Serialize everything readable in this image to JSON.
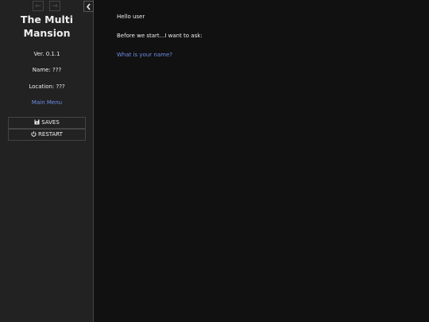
{
  "sidebar": {
    "history_back_icon": "←",
    "history_forward_icon": "→",
    "story_title_line1": "The Multi",
    "story_title_line2": "Mansion",
    "version": "Ver. 0.1.1",
    "name": "Name: ???",
    "location": "Location: ???",
    "main_menu_label": "Main Menu",
    "saves_label": "SAVES",
    "restart_label": "RESTART"
  },
  "passage": {
    "line1": "Hello user",
    "line2": "Before we start...I want to ask:",
    "name_link": "What is your name?"
  },
  "colors": {
    "background": "#111111",
    "sidebar_background": "#222222",
    "link": "#6d8ee8",
    "text": "#eeeeee"
  }
}
